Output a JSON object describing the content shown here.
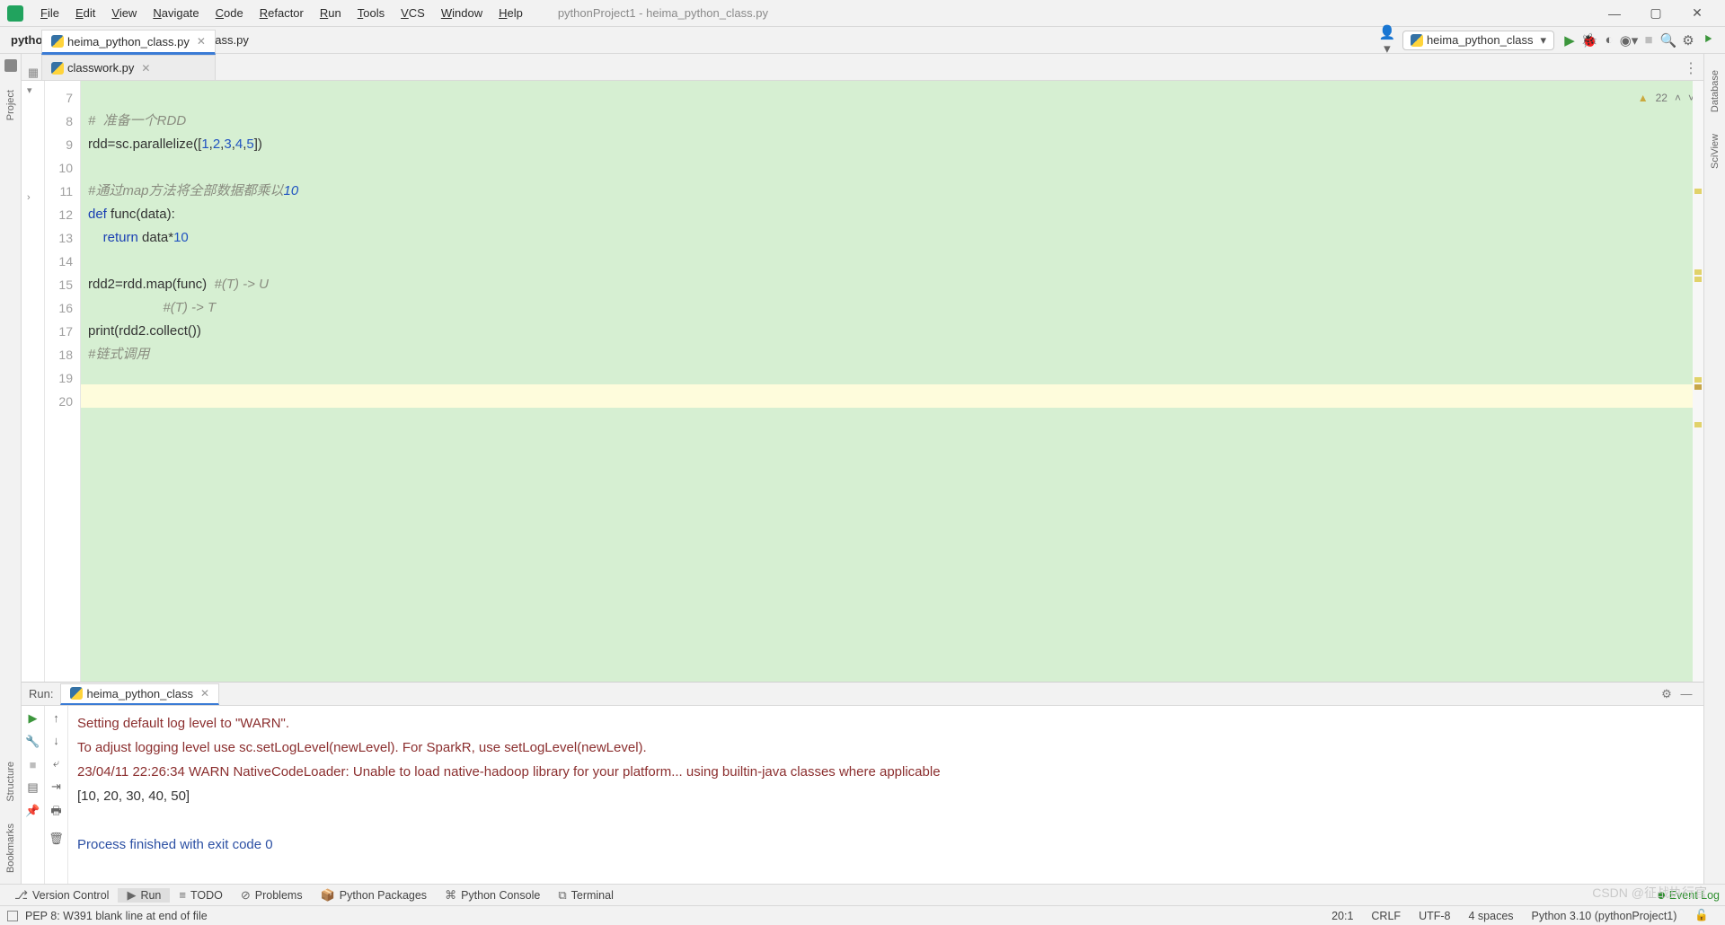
{
  "menubar": {
    "items": [
      "File",
      "Edit",
      "View",
      "Navigate",
      "Code",
      "Refactor",
      "Run",
      "Tools",
      "VCS",
      "Window",
      "Help"
    ],
    "title": "pythonProject1 - heima_python_class.py"
  },
  "breadcrumb": {
    "project": "pythonProject1",
    "file": "heima_python_class.py"
  },
  "run_config": {
    "selected": "heima_python_class"
  },
  "left_tools": [
    "Project"
  ],
  "left_tools_bottom": [
    "Bookmarks",
    "Structure"
  ],
  "right_tools": [
    "Database",
    "SciView"
  ],
  "editor_tabs": [
    {
      "label": "heima_python_class.py",
      "active": true
    },
    {
      "label": "classwork.py",
      "active": false
    }
  ],
  "inspection": {
    "warnings": "22"
  },
  "gutter_start": 7,
  "gutter_end": 20,
  "code_lines": [
    "",
    "#  准备一个RDD",
    "rdd=sc.parallelize([1,2,3,4,5])",
    "",
    "#通过map方法将全部数据都乘以10",
    "def func(data):",
    "    return data*10",
    "",
    "rdd2=rdd.map(func)  #(T) -> U",
    "                    #(T) -> T",
    "print(rdd2.collect())",
    "#链式调用",
    "",
    ""
  ],
  "run_panel": {
    "label": "Run:",
    "tab": "heima_python_class",
    "console": [
      {
        "cls": "dr",
        "text": "Setting default log level to \"WARN\"."
      },
      {
        "cls": "dr",
        "text": "To adjust logging level use sc.setLogLevel(newLevel). For SparkR, use setLogLevel(newLevel)."
      },
      {
        "cls": "dr",
        "text": "23/04/11 22:26:34 WARN NativeCodeLoader: Unable to load native-hadoop library for your platform... using builtin-java classes where applicable"
      },
      {
        "cls": "",
        "text": "[10, 20, 30, 40, 50]"
      },
      {
        "cls": "",
        "text": ""
      },
      {
        "cls": "bl",
        "text": "Process finished with exit code 0"
      }
    ]
  },
  "tool_strip": {
    "items": [
      {
        "label": "Version Control",
        "icon": "⎇",
        "active": false
      },
      {
        "label": "Run",
        "icon": "▶",
        "active": true
      },
      {
        "label": "TODO",
        "icon": "≡",
        "active": false
      },
      {
        "label": "Problems",
        "icon": "⊘",
        "active": false
      },
      {
        "label": "Python Packages",
        "icon": "📦",
        "active": false
      },
      {
        "label": "Python Console",
        "icon": "⌘",
        "active": false
      },
      {
        "label": "Terminal",
        "icon": "⧉",
        "active": false
      }
    ],
    "event_log": "Event Log"
  },
  "status": {
    "message": "PEP 8: W391 blank line at end of file",
    "pos": "20:1",
    "eol": "CRLF",
    "enc": "UTF-8",
    "indent": "4 spaces",
    "interp": "Python 3.10 (pythonProject1)"
  },
  "watermark": "CSDN @征战执行官"
}
